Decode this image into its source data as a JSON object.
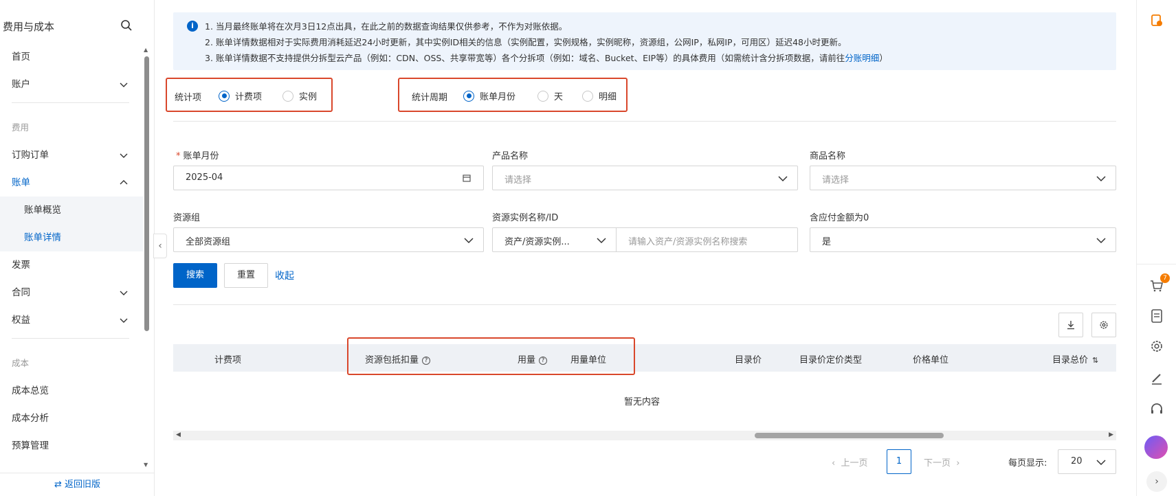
{
  "sidebar": {
    "title": "费用与成本",
    "items": [
      {
        "label": "首页"
      },
      {
        "label": "账户"
      },
      {
        "label": "费用"
      },
      {
        "label": "订购订单"
      },
      {
        "label": "账单"
      },
      {
        "label": "账单概览"
      },
      {
        "label": "账单详情"
      },
      {
        "label": "发票"
      },
      {
        "label": "合同"
      },
      {
        "label": "权益"
      },
      {
        "label": "成本"
      },
      {
        "label": "成本总览"
      },
      {
        "label": "成本分析"
      },
      {
        "label": "预算管理"
      }
    ],
    "footer": "⇄  返回旧版"
  },
  "notice": {
    "line1": "1. 当月最终账单将在次月3日12点出具，在此之前的数据查询结果仅供参考，不作为对账依据。",
    "line2": "2. 账单详情数据相对于实际费用消耗延迟24小时更新，其中实例ID相关的信息（实例配置，实例规格，实例昵称，资源组，公网IP，私网IP，可用区）延迟48小时更新。",
    "line3_prefix": "3. 账单详情数据不支持提供分拆型云产品（例如：CDN、OSS、共享带宽等）各个分拆项（例如：域名、Bucket、EIP等）的具体费用（如需统计含分拆项数据，请前往",
    "line3_link": "分账明细",
    "line3_suffix": "）"
  },
  "stat_item": {
    "label": "统计项",
    "options": [
      "计费项",
      "实例"
    ],
    "selected": "计费项"
  },
  "stat_period": {
    "label": "统计周期",
    "options": [
      "账单月份",
      "天",
      "明细"
    ],
    "selected": "账单月份"
  },
  "form": {
    "bill_month": {
      "label": "账单月份",
      "value": "2025-04"
    },
    "product_name": {
      "label": "产品名称",
      "placeholder": "请选择"
    },
    "commodity_name": {
      "label": "商品名称",
      "placeholder": "请选择"
    },
    "resource_group": {
      "label": "资源组",
      "value": "全部资源组"
    },
    "resource_instance": {
      "label": "资源实例名称/ID",
      "type_value": "资产/资源实例...",
      "placeholder": "请输入资产/资源实例名称搜索"
    },
    "zero_amount": {
      "label": "含应付金额为0",
      "value": "是"
    }
  },
  "actions": {
    "search": "搜索",
    "reset": "重置",
    "collapse": "收起"
  },
  "table": {
    "columns": [
      "计费项",
      "资源包抵扣量",
      "用量",
      "用量单位",
      "目录价",
      "目录价定价类型",
      "价格单位",
      "目录总价"
    ],
    "empty": "暂无内容"
  },
  "pagination": {
    "prev": "上一页",
    "page": "1",
    "next": "下一页",
    "size_label": "每页显示:",
    "size": "20"
  },
  "rail": {
    "cart_count": "7"
  }
}
